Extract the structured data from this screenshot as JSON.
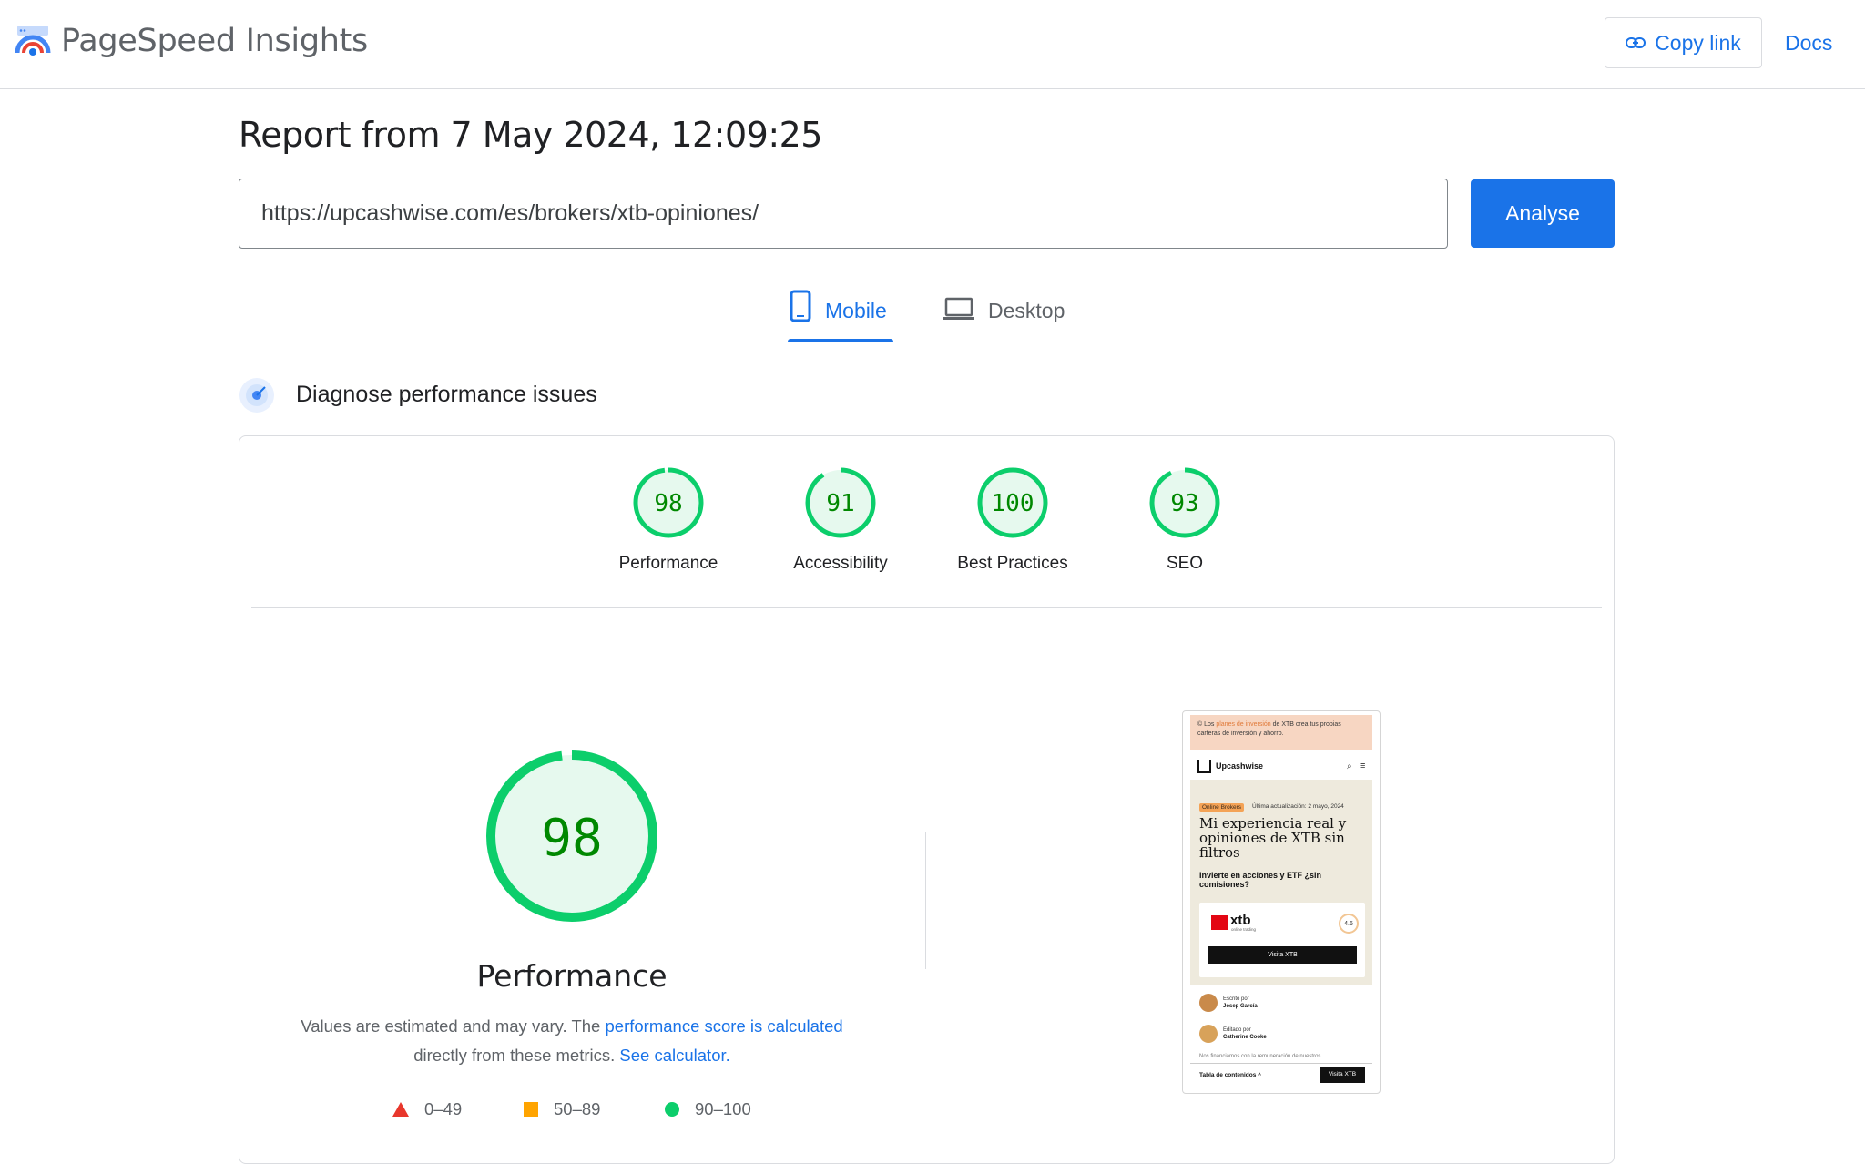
{
  "header": {
    "app_title": "PageSpeed Insights",
    "logo_icon": "pagespeed-logo-icon",
    "copy_link_label": "Copy link",
    "copy_link_icon": "link-icon",
    "docs_label": "Docs"
  },
  "report": {
    "title": "Report from 7 May 2024, 12:09:25",
    "url": "https://upcashwise.com/es/brokers/xtb-opiniones/",
    "analyse_label": "Analyse"
  },
  "tabs": [
    {
      "label": "Mobile",
      "icon": "smartphone-icon",
      "active": true
    },
    {
      "label": "Desktop",
      "icon": "laptop-icon",
      "active": false
    }
  ],
  "section": {
    "title": "Diagnose performance issues",
    "icon": "diagnose-icon"
  },
  "scores": [
    {
      "value": "98",
      "name": "Performance"
    },
    {
      "value": "91",
      "name": "Accessibility"
    },
    {
      "value": "100",
      "name": "Best Practices"
    },
    {
      "value": "93",
      "name": "SEO"
    }
  ],
  "performance": {
    "score": "98",
    "title": "Performance",
    "description_1": "Values are estimated and may vary. The ",
    "description_link_1": "performance score is calculated",
    "description_2": " directly from these metrics. ",
    "description_link_2": "See calculator."
  },
  "legend": [
    {
      "range": "0–49",
      "shape": "triangle",
      "color": "#e8372c"
    },
    {
      "range": "50–89",
      "shape": "square",
      "color": "#ffa400"
    },
    {
      "range": "90–100",
      "shape": "circle",
      "color": "#0cce6b"
    }
  ],
  "colors": {
    "accent": "#1a73e8",
    "pass": "#0cce6b",
    "pass_text": "#008800",
    "pass_fill": "#e6f9ee"
  },
  "thumbnail": {
    "banner_1": "© Los ",
    "banner_highlight": "planes de inversión",
    "banner_2": " de XTB crea tus propias carteras de inversión y ahorro.",
    "brand": "Upcashwise",
    "chip": "Online Brokers",
    "meta": "Última actualización: 2 mayo, 2024",
    "headline": "Mi experiencia real y opiniones de XTB sin filtros",
    "subhead": "Invierte en acciones y ETF ¿sin comisiones?",
    "broker_logo": "xtb",
    "broker_tagline": "online trading",
    "rating": "4.6",
    "cta": "Visita XTB",
    "author_1_label": "Escrito por",
    "author_1_name": "Josep García",
    "author_2_label": "Editado por",
    "author_2_name": "Catherine Cooke",
    "disclaimer": "Nos financiamos con la remuneración de nuestros",
    "toc": "Tabla de contenidos ^",
    "footer_cta": "Visita XTB"
  }
}
